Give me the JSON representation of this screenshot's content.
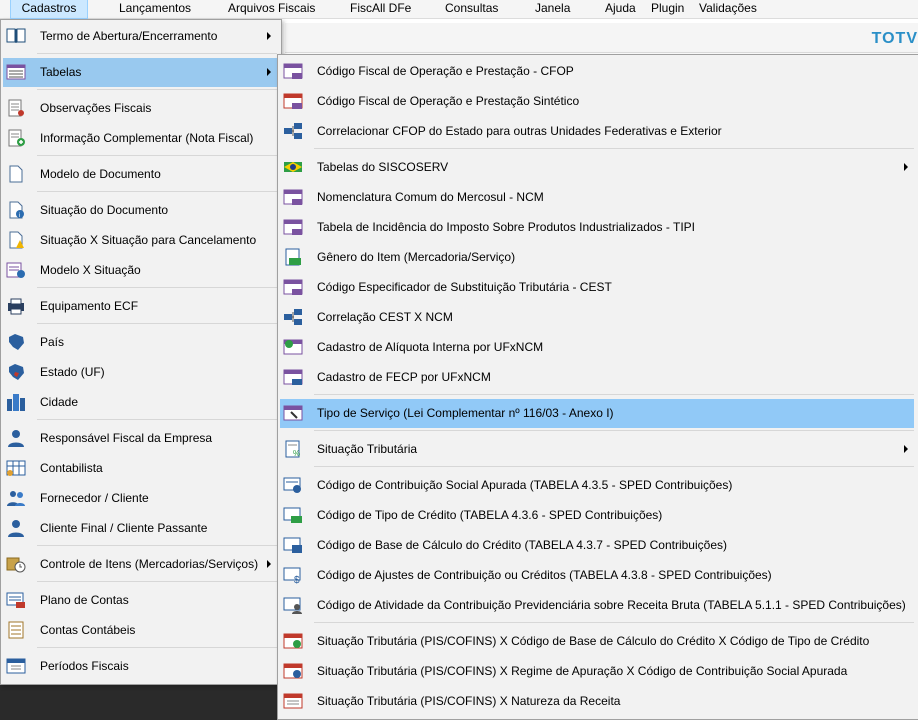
{
  "menubar": {
    "items": [
      "Cadastros",
      "Lançamentos",
      "Arquivos Fiscais",
      "FiscAll DFe",
      "Consultas",
      "Janela",
      "Ajuda",
      "Plugin",
      "Validações"
    ]
  },
  "brand": "TOTV",
  "left_menu": {
    "items": [
      {
        "label": "Termo de Abertura/Encerramento",
        "icon": "book-icon"
      },
      {
        "label": "Tabelas",
        "icon": "table-icon"
      },
      {
        "label": "Observações Fiscais",
        "icon": "document-lines-icon"
      },
      {
        "label": "Informação Complementar (Nota Fiscal)",
        "icon": "document-plus-icon"
      },
      {
        "label": "Modelo de Documento",
        "icon": "blank-document-icon"
      },
      {
        "label": "Situação do Documento",
        "icon": "document-info-icon"
      },
      {
        "label": "Situação X Situação para Cancelamento",
        "icon": "document-warning-icon"
      },
      {
        "label": "Modelo X Situação",
        "icon": "form-info-icon"
      },
      {
        "label": "Equipamento ECF",
        "icon": "printer-icon"
      },
      {
        "label": "País",
        "icon": "country-map-icon"
      },
      {
        "label": "Estado (UF)",
        "icon": "state-map-icon"
      },
      {
        "label": "Cidade",
        "icon": "city-buildings-icon"
      },
      {
        "label": "Responsável Fiscal da Empresa",
        "icon": "person-icon"
      },
      {
        "label": "Contabilista",
        "icon": "calculator-person-icon"
      },
      {
        "label": "Fornecedor / Cliente",
        "icon": "people-icon"
      },
      {
        "label": "Cliente Final / Cliente Passante",
        "icon": "person-icon"
      },
      {
        "label": "Controle de Itens (Mercadorias/Serviços)",
        "icon": "box-clock-icon"
      },
      {
        "label": "Plano de Contas",
        "icon": "chart-accounts-icon"
      },
      {
        "label": "Contas Contábeis",
        "icon": "accounts-list-icon"
      },
      {
        "label": "Períodos Fiscais",
        "icon": "calendar-money-icon"
      }
    ]
  },
  "right_menu": {
    "items": [
      {
        "label": "Código Fiscal de Operação e Prestação - CFOP",
        "icon": "cfop-icon"
      },
      {
        "label": "Código Fiscal de Operação e Prestação Sintético",
        "icon": "cfop-red-icon"
      },
      {
        "label": "Correlacionar CFOP do Estado para outras Unidades Federativas e Exterior",
        "icon": "correlation-icon"
      },
      {
        "label": "Tabelas do SISCOSERV",
        "icon": "brazil-flag-icon"
      },
      {
        "label": "Nomenclatura Comum do Mercosul - NCM",
        "icon": "ncm-icon"
      },
      {
        "label": "Tabela de Incidência do Imposto Sobre Produtos Industrializados - TIPI",
        "icon": "tipi-icon"
      },
      {
        "label": "Gênero do Item (Mercadoria/Serviço)",
        "icon": "money-document-icon"
      },
      {
        "label": "Código Especificador de Substituição Tributária - CEST",
        "icon": "cest-icon"
      },
      {
        "label": "Correlação CEST X NCM",
        "icon": "correlation-icon"
      },
      {
        "label": "Cadastro de Alíquota Interna por UFxNCM",
        "icon": "money-table-icon"
      },
      {
        "label": "Cadastro de FECP por UFxNCM",
        "icon": "fecp-icon"
      },
      {
        "label": "Tipo de Serviço (Lei Complementar nº 116/03 - Anexo I)",
        "icon": "service-tool-icon"
      },
      {
        "label": "Situação Tributária",
        "icon": "tax-percent-icon"
      },
      {
        "label": "Código de Contribuição Social Apurada (TABELA 4.3.5 - SPED Contribuições)",
        "icon": "contribution-icon"
      },
      {
        "label": "Código de Tipo de Crédito (TABELA 4.3.6 - SPED Contribuições)",
        "icon": "credit-icon"
      },
      {
        "label": "Código de Base de Cálculo do Crédito (TABELA 4.3.7 - SPED Contribuições)",
        "icon": "calc-base-icon"
      },
      {
        "label": "Código de Ajustes de Contribuição ou Créditos (TABELA 4.3.8 - SPED Contribuições)",
        "icon": "adjust-dollar-icon"
      },
      {
        "label": "Código de Atividade da Contribuição Previdenciária sobre Receita Bruta (TABELA 5.1.1 - SPED Contribuições)",
        "icon": "activity-person-icon"
      },
      {
        "label": "Situação Tributária (PIS/COFINS)  X  Código de Base de Cálculo do Crédito  X  Código de Tipo de Crédito",
        "icon": "money-red-icon"
      },
      {
        "label": "Situação Tributária (PIS/COFINS)  X  Regime de Apuração  X  Código de Contribuição Social Apurada",
        "icon": "money-check-icon"
      },
      {
        "label": "Situação Tributária (PIS/COFINS)  X  Natureza da Receita",
        "icon": "document-red-icon"
      }
    ]
  }
}
